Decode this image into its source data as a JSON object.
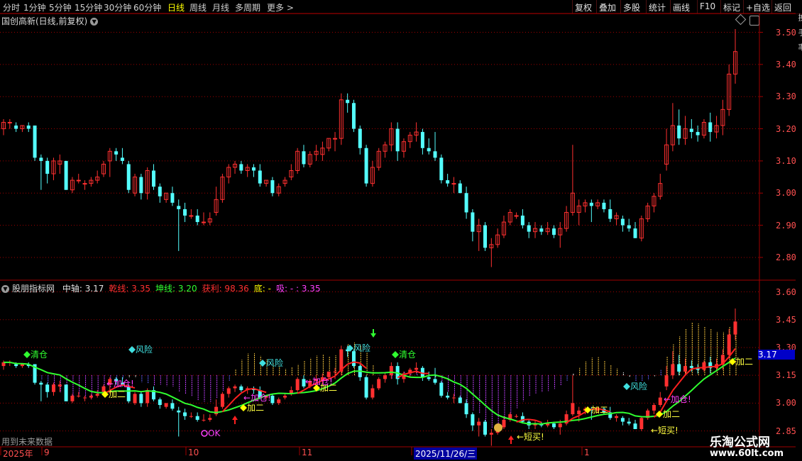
{
  "toolbar": {
    "left": [
      "分时",
      "1分钟",
      "5分钟",
      "15分钟",
      "30分钟",
      "60分钟",
      "日线",
      "周线",
      "月线",
      "多周期",
      "更多 >"
    ],
    "active": "日线",
    "right": [
      "复权",
      "叠加",
      "多股",
      "统计",
      "画线",
      "F10",
      "标记",
      "+自选",
      "返回"
    ]
  },
  "main_panel": {
    "title": "国创高新(日线,前复权)",
    "price_labels": [
      "3.50",
      "3.40",
      "3.30",
      "3.20",
      "3.10",
      "3.00",
      "2.90",
      "2.80"
    ],
    "side_strip": "换手率"
  },
  "indicator_panel": {
    "name": "股朋指标网",
    "legend": [
      {
        "label": "中轴:",
        "value": "3.17",
        "color": "#e0e0e0"
      },
      {
        "label": "乾线:",
        "value": "3.35",
        "color": "#ff3030"
      },
      {
        "label": "坤线:",
        "value": "3.20",
        "color": "#30ff30"
      },
      {
        "label": "获利:",
        "value": "98.36",
        "color": "#ff3030"
      },
      {
        "label": "底:",
        "value": "-",
        "color": "#ffff00"
      },
      {
        "label": "吸:",
        "value": "- : 3.35",
        "color": "#ff40ff"
      }
    ],
    "price_labels": [
      "3.60",
      "3.45",
      "3.30",
      "3.15",
      "3.00",
      "2.85"
    ],
    "current_price": "3.17",
    "signals": {
      "qingcang": "清仓",
      "fengxian": "风险",
      "jiaer": "加二",
      "jiacang": "←加仓!",
      "duanmai": "←短买!",
      "ok": "OK"
    },
    "footer_note": "用到未来数据"
  },
  "time_axis": {
    "labels": [
      "2025年",
      "9",
      "10",
      "11",
      "2025/11/26/三",
      "1"
    ]
  },
  "watermark": {
    "line1": "乐淘公式网",
    "line2": "www.60lt.com"
  },
  "colors": {
    "up": "#ff3030",
    "down": "#54ffff",
    "axis": "#a00000",
    "grid": "#a00000",
    "active_tab": "#ffff00"
  },
  "chart_data": {
    "type": "candlestick",
    "ylim": [
      2.76,
      3.52
    ],
    "ohlc": [
      [
        3.2,
        3.23,
        3.18,
        3.22
      ],
      [
        3.22,
        3.23,
        3.2,
        3.22
      ],
      [
        3.21,
        3.22,
        3.19,
        3.2
      ],
      [
        3.2,
        3.21,
        3.19,
        3.21
      ],
      [
        3.21,
        3.22,
        3.19,
        3.2
      ],
      [
        3.21,
        3.21,
        3.1,
        3.11
      ],
      [
        3.11,
        3.12,
        3.01,
        3.1
      ],
      [
        3.1,
        3.11,
        3.03,
        3.06
      ],
      [
        3.06,
        3.11,
        3.04,
        3.1
      ],
      [
        3.09,
        3.12,
        3.06,
        3.1
      ],
      [
        3.1,
        3.1,
        3.01,
        3.01
      ],
      [
        3.01,
        3.05,
        3.0,
        3.04
      ],
      [
        3.04,
        3.06,
        3.03,
        3.04
      ],
      [
        3.03,
        3.04,
        3.01,
        3.03
      ],
      [
        3.03,
        3.05,
        3.02,
        3.04
      ],
      [
        3.04,
        3.07,
        3.03,
        3.05
      ],
      [
        3.06,
        3.1,
        3.05,
        3.09
      ],
      [
        3.1,
        3.14,
        3.05,
        3.13
      ],
      [
        3.13,
        3.14,
        3.1,
        3.12
      ],
      [
        3.11,
        3.14,
        3.09,
        3.1
      ],
      [
        3.09,
        3.1,
        3.0,
        3.01
      ],
      [
        3.0,
        3.06,
        2.99,
        3.05
      ],
      [
        3.05,
        3.06,
        2.98,
        3.0
      ],
      [
        3.0,
        3.08,
        2.98,
        3.07
      ],
      [
        3.07,
        3.09,
        3.01,
        3.02
      ],
      [
        3.02,
        3.03,
        2.97,
        2.99
      ],
      [
        2.98,
        3.0,
        2.97,
        3.0
      ],
      [
        3.0,
        3.02,
        2.96,
        2.97
      ],
      [
        2.96,
        2.98,
        2.82,
        2.95
      ],
      [
        2.95,
        2.97,
        2.91,
        2.93
      ],
      [
        2.93,
        2.95,
        2.92,
        2.93
      ],
      [
        2.93,
        2.95,
        2.9,
        2.91
      ],
      [
        2.91,
        2.94,
        2.9,
        2.91
      ],
      [
        2.91,
        2.94,
        2.9,
        2.92
      ],
      [
        2.94,
        3.02,
        2.93,
        2.98
      ],
      [
        2.98,
        3.06,
        2.97,
        3.05
      ],
      [
        3.05,
        3.09,
        3.03,
        3.08
      ],
      [
        3.08,
        3.1,
        3.06,
        3.09
      ],
      [
        3.09,
        3.1,
        3.06,
        3.07
      ],
      [
        3.07,
        3.09,
        3.05,
        3.08
      ],
      [
        3.08,
        3.09,
        3.05,
        3.07
      ],
      [
        3.07,
        3.09,
        3.02,
        3.03
      ],
      [
        3.03,
        3.04,
        3.02,
        3.04
      ],
      [
        3.04,
        3.05,
        2.99,
        3.0
      ],
      [
        3.0,
        3.03,
        2.99,
        3.02
      ],
      [
        3.03,
        3.05,
        3.02,
        3.04
      ],
      [
        3.05,
        3.09,
        3.04,
        3.07
      ],
      [
        3.07,
        3.14,
        3.06,
        3.13
      ],
      [
        3.13,
        3.15,
        3.08,
        3.09
      ],
      [
        3.09,
        3.13,
        3.08,
        3.12
      ],
      [
        3.12,
        3.15,
        3.1,
        3.13
      ],
      [
        3.12,
        3.16,
        3.1,
        3.14
      ],
      [
        3.14,
        3.17,
        3.13,
        3.17
      ],
      [
        3.17,
        3.19,
        3.13,
        3.17
      ],
      [
        3.17,
        3.31,
        3.15,
        3.29
      ],
      [
        3.29,
        3.31,
        3.25,
        3.28
      ],
      [
        3.28,
        3.29,
        3.19,
        3.2
      ],
      [
        3.2,
        3.21,
        3.12,
        3.14
      ],
      [
        3.14,
        3.15,
        3.02,
        3.03
      ],
      [
        3.03,
        3.1,
        3.02,
        3.08
      ],
      [
        3.08,
        3.14,
        3.07,
        3.13
      ],
      [
        3.13,
        3.16,
        3.11,
        3.15
      ],
      [
        3.15,
        3.22,
        3.13,
        3.2
      ],
      [
        3.2,
        3.22,
        3.1,
        3.13
      ],
      [
        3.13,
        3.17,
        3.11,
        3.16
      ],
      [
        3.16,
        3.19,
        3.14,
        3.18
      ],
      [
        3.18,
        3.22,
        3.16,
        3.19
      ],
      [
        3.19,
        3.2,
        3.12,
        3.14
      ],
      [
        3.14,
        3.17,
        3.12,
        3.13
      ],
      [
        3.13,
        3.19,
        3.1,
        3.11
      ],
      [
        3.11,
        3.12,
        3.03,
        3.04
      ],
      [
        3.04,
        3.06,
        3.02,
        3.03
      ],
      [
        3.03,
        3.05,
        3.0,
        3.03
      ],
      [
        3.03,
        3.04,
        3.0,
        3.0
      ],
      [
        3.0,
        3.02,
        2.92,
        2.94
      ],
      [
        2.94,
        2.95,
        2.85,
        2.88
      ],
      [
        2.88,
        2.92,
        2.82,
        2.9
      ],
      [
        2.9,
        2.91,
        2.82,
        2.83
      ],
      [
        2.83,
        2.86,
        2.77,
        2.84
      ],
      [
        2.84,
        2.89,
        2.83,
        2.87
      ],
      [
        2.87,
        2.93,
        2.86,
        2.91
      ],
      [
        2.91,
        2.95,
        2.9,
        2.94
      ],
      [
        2.93,
        2.94,
        2.92,
        2.93
      ],
      [
        2.93,
        2.95,
        2.89,
        2.9
      ],
      [
        2.9,
        2.91,
        2.86,
        2.88
      ],
      [
        2.88,
        2.91,
        2.86,
        2.89
      ],
      [
        2.89,
        2.9,
        2.87,
        2.88
      ],
      [
        2.88,
        2.91,
        2.87,
        2.89
      ],
      [
        2.89,
        2.9,
        2.86,
        2.87
      ],
      [
        2.87,
        2.91,
        2.83,
        2.89
      ],
      [
        2.89,
        2.96,
        2.88,
        2.94
      ],
      [
        2.94,
        3.15,
        2.93,
        3.0
      ],
      [
        2.94,
        2.98,
        2.9,
        2.96
      ],
      [
        2.96,
        2.98,
        2.94,
        2.97
      ],
      [
        2.97,
        2.98,
        2.91,
        2.96
      ],
      [
        2.96,
        2.98,
        2.95,
        2.97
      ],
      [
        2.97,
        2.98,
        2.94,
        2.95
      ],
      [
        2.95,
        2.98,
        2.91,
        2.92
      ],
      [
        2.92,
        2.94,
        2.9,
        2.93
      ],
      [
        2.92,
        2.93,
        2.88,
        2.9
      ],
      [
        2.9,
        2.92,
        2.88,
        2.89
      ],
      [
        2.89,
        2.91,
        2.86,
        2.86
      ],
      [
        2.86,
        2.93,
        2.85,
        2.92
      ],
      [
        2.92,
        2.97,
        2.91,
        2.96
      ],
      [
        2.96,
        3.0,
        2.94,
        2.99
      ],
      [
        2.99,
        3.06,
        2.98,
        3.03
      ],
      [
        3.09,
        3.2,
        3.07,
        3.15
      ],
      [
        3.15,
        3.28,
        3.13,
        3.21
      ],
      [
        3.21,
        3.26,
        3.15,
        3.17
      ],
      [
        3.17,
        3.24,
        3.15,
        3.2
      ],
      [
        3.2,
        3.23,
        3.17,
        3.19
      ],
      [
        3.19,
        3.21,
        3.16,
        3.18
      ],
      [
        3.18,
        3.23,
        3.17,
        3.22
      ],
      [
        3.22,
        3.25,
        3.16,
        3.19
      ],
      [
        3.19,
        3.24,
        3.17,
        3.21
      ],
      [
        3.21,
        3.29,
        3.18,
        3.26
      ],
      [
        3.26,
        3.4,
        3.24,
        3.37
      ],
      [
        3.37,
        3.51,
        3.34,
        3.44
      ]
    ],
    "indicator_series": [
      {
        "name": "中轴",
        "color": "#e0e0e0",
        "last": 3.17
      },
      {
        "name": "乾线",
        "color": "#ff3030",
        "last": 3.35
      },
      {
        "name": "坤线",
        "color": "#30ff30",
        "last": 3.2
      }
    ],
    "indicator_ylim": [
      2.78,
      3.62
    ]
  }
}
